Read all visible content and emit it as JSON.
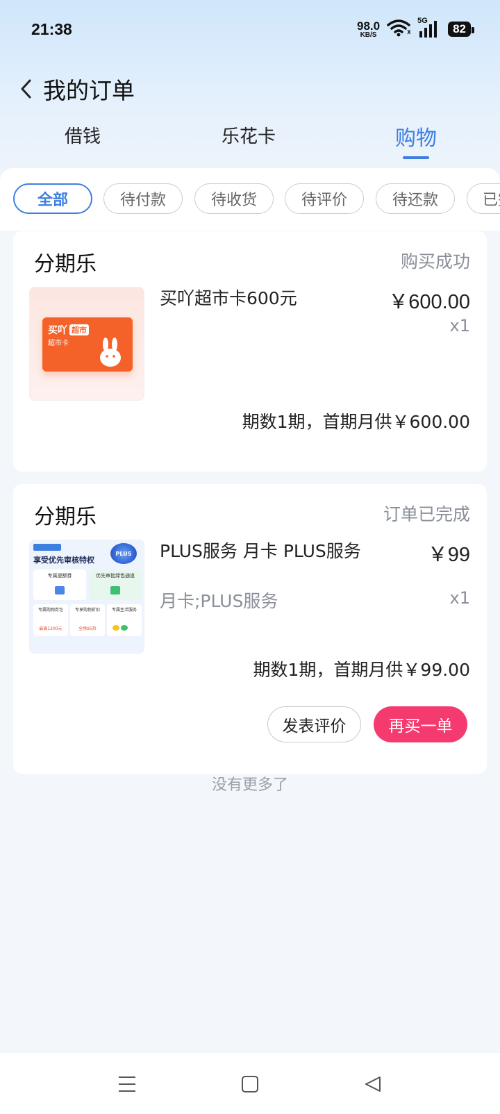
{
  "status_bar": {
    "time": "21:38",
    "net_speed_value": "98.0",
    "net_speed_unit": "KB/S",
    "network_type": "5G",
    "battery": "82"
  },
  "nav": {
    "title": "我的订单"
  },
  "main_tabs": [
    {
      "label": "借钱",
      "active": false
    },
    {
      "label": "乐花卡",
      "active": false
    },
    {
      "label": "购物",
      "active": true
    }
  ],
  "filter_chips": [
    {
      "label": "全部",
      "active": true
    },
    {
      "label": "待付款",
      "active": false
    },
    {
      "label": "待收货",
      "active": false
    },
    {
      "label": "待评价",
      "active": false
    },
    {
      "label": "待还款",
      "active": false
    },
    {
      "label": "已完成",
      "active": false
    }
  ],
  "orders": [
    {
      "shop": "分期乐",
      "status": "购买成功",
      "product_name": "买吖超市卡600元",
      "price": "￥600.00",
      "quantity": "x1",
      "spec": "",
      "installment": "期数1期，首期月供￥600.00",
      "thumb": {
        "brand": "买吖",
        "tag": "超市",
        "subtitle": "超市卡"
      }
    },
    {
      "shop": "分期乐",
      "status": "订单已完成",
      "product_name": "PLUS服务 月卡 PLUS服务",
      "price": "￥99",
      "quantity": "x1",
      "spec": "月卡;PLUS服务",
      "installment": "期数1期，首期月供￥99.00",
      "thumb": {
        "headline": "享受优先审核特权",
        "badge": "PLUS",
        "box1": "专属提额券",
        "box2": "优先审批绿色通道",
        "box3": "专属购物券包",
        "box4": "专享购物折扣",
        "box5": "专属生活服务",
        "box3_value": "最高1200元",
        "box4_value": "全场95折"
      },
      "actions": {
        "review": "发表评价",
        "rebuy": "再买一单"
      }
    }
  ],
  "footer": {
    "no_more": "没有更多了"
  },
  "colors": {
    "accent": "#3d7fe0",
    "primary_button": "#f43a6e",
    "card_orange": "#f4622a"
  }
}
